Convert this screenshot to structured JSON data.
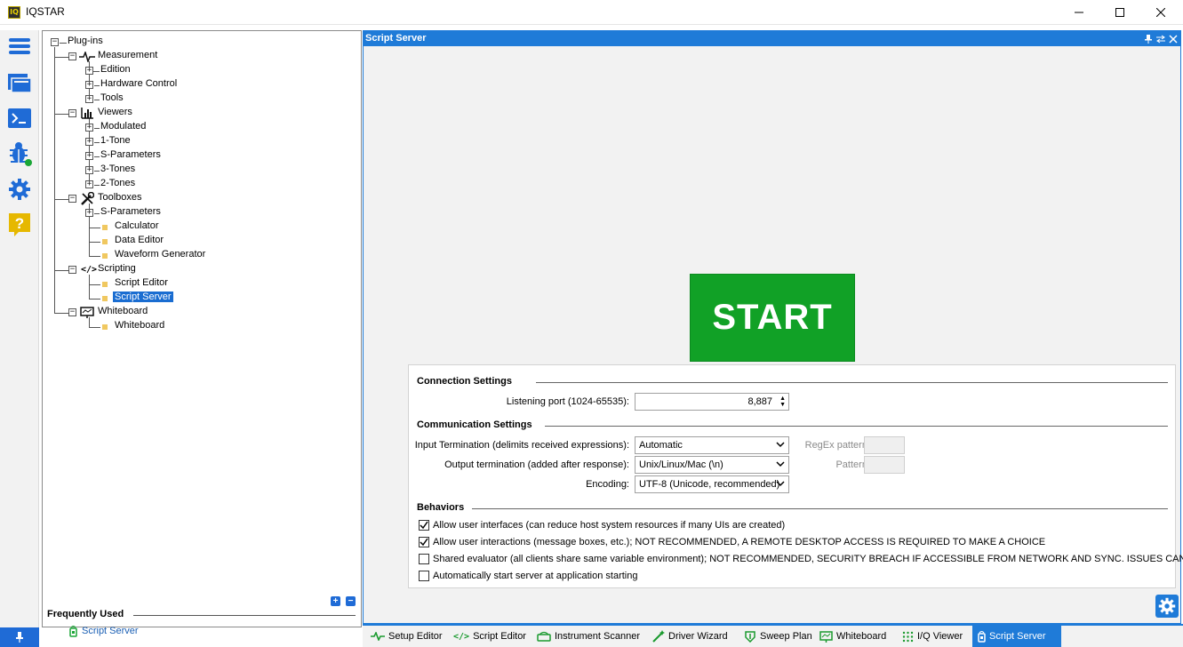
{
  "window": {
    "title": "IQSTAR",
    "logo_text": "IQ"
  },
  "tree": {
    "items": [
      {
        "label": "Plug-ins"
      },
      {
        "label": "Measurement"
      },
      {
        "label": "Edition"
      },
      {
        "label": "Hardware Control"
      },
      {
        "label": "Tools"
      },
      {
        "label": "Viewers"
      },
      {
        "label": "Modulated"
      },
      {
        "label": "1-Tone"
      },
      {
        "label": "S-Parameters"
      },
      {
        "label": "3-Tones"
      },
      {
        "label": "2-Tones"
      },
      {
        "label": "Toolboxes"
      },
      {
        "label": "S-Parameters"
      },
      {
        "label": "Calculator"
      },
      {
        "label": "Data Editor"
      },
      {
        "label": "Waveform Generator"
      },
      {
        "label": "Scripting"
      },
      {
        "label": "Script Editor"
      },
      {
        "label": "Script Server"
      },
      {
        "label": "Whiteboard"
      },
      {
        "label": "Whiteboard"
      }
    ],
    "selected": "Script Server",
    "frequently_used_title": "Frequently Used",
    "frequently_used": [
      "Script Server"
    ]
  },
  "main": {
    "header": "Script Server",
    "start_label": "START",
    "start_color": "#11a126",
    "connection": {
      "title": "Connection Settings",
      "port_label": "Listening port (1024-65535):",
      "port_value": "8,887"
    },
    "communication": {
      "title": "Communication Settings",
      "input_label": "Input Termination (delimits received expressions):",
      "input_value": "Automatic",
      "regex_label": "RegEx pattern:",
      "output_label": "Output termination (added after response):",
      "output_value": "Unix/Linux/Mac (\\n)",
      "pattern_label": "Pattern:",
      "encoding_label": "Encoding:",
      "encoding_value": "UTF-8 (Unicode, recommended)"
    },
    "behaviors": {
      "title": "Behaviors",
      "options": [
        {
          "label": "Allow user interfaces (can reduce host system resources if many UIs are created)",
          "checked": true
        },
        {
          "label": "Allow user interactions (message boxes, etc.); NOT RECOMMENDED, A REMOTE DESKTOP ACCESS IS REQUIRED TO MAKE A CHOICE",
          "checked": true
        },
        {
          "label": "Shared evaluator (all clients share same variable environment); NOT RECOMMENDED, SECURITY BREACH IF ACCESSIBLE FROM NETWORK AND SYNC. ISSUES CAN HAPPEN",
          "checked": false
        },
        {
          "label": "Automatically start server at application starting",
          "checked": false
        }
      ]
    }
  },
  "tabs": [
    {
      "label": "Setup Editor",
      "icon": "pulse-icon"
    },
    {
      "label": "Script Editor",
      "icon": "code-icon"
    },
    {
      "label": "Instrument Scanner",
      "icon": "scanner-icon"
    },
    {
      "label": "Driver Wizard",
      "icon": "wand-icon"
    },
    {
      "label": "Sweep Plan",
      "icon": "sweep-icon"
    },
    {
      "label": "Whiteboard",
      "icon": "whiteboard-icon"
    },
    {
      "label": "I/Q Viewer",
      "icon": "iq-dots-icon"
    },
    {
      "label": "Script Server",
      "icon": "server-icon",
      "active": true
    }
  ],
  "colors": {
    "accent": "#1f7bd8",
    "selection": "#1a6dd1",
    "leaf": "#f0c860"
  }
}
